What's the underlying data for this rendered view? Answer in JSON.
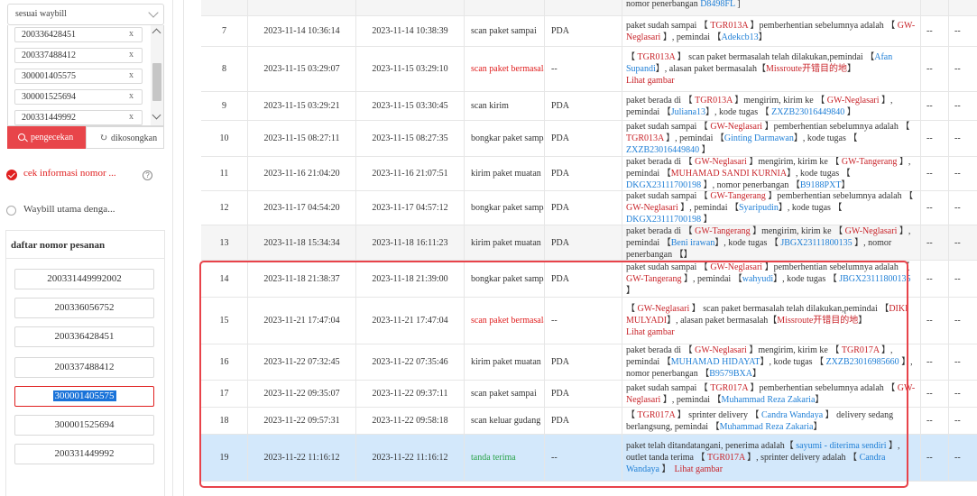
{
  "left": {
    "select_label": "sesuai waybill",
    "waybills": [
      "200336428451",
      "200337488412",
      "300001405575",
      "300001525694",
      "200331449992"
    ],
    "search_button": "pengecekan",
    "clear_button": "dikosongkan",
    "option_selected": "cek informasi nomor ...",
    "option_other": "Waybill utama denga...",
    "orders_title": "daftar nomor pesanan",
    "orders": [
      "200331449992002",
      "200336056752",
      "200336428451",
      "200337488412",
      "300001405575",
      "300001525694",
      "200331449992"
    ],
    "active_order_index": 4
  },
  "table": {
    "rows": [
      {
        "no": "",
        "t1": "",
        "t2": "",
        "type": "",
        "src": "",
        "desc": [
          [
            "",
            "nomor penerbangan "
          ],
          [
            "b",
            "D8498FL"
          ],
          [
            "",
            " ]"
          ]
        ],
        "a": "",
        "b": ""
      },
      {
        "no": "7",
        "t1": "2023-11-14 10:36:14",
        "t2": "2023-11-14 10:38:39",
        "type": "scan paket sampai",
        "src": "PDA",
        "desc": [
          [
            "",
            "paket sudah sampai 【 "
          ],
          [
            "r",
            "TGR013A"
          ],
          [
            "",
            " 】pemberhentian sebelumnya adalah 【 "
          ],
          [
            "r",
            "GW-Neglasari"
          ],
          [
            "",
            " 】, pemindai 【"
          ],
          [
            "b",
            "Adekcb13"
          ],
          [
            "",
            "】"
          ]
        ],
        "a": "--",
        "b": "--"
      },
      {
        "no": "8",
        "t1": "2023-11-15 03:29:07",
        "t2": "2023-11-15 03:29:10",
        "type": "scan paket bermasalah",
        "src": "--",
        "desc": [
          [
            "",
            "【 "
          ],
          [
            "r",
            "TGR013A"
          ],
          [
            "",
            " 】 scan paket bermasalah telah dilakukan,pemindai 【"
          ],
          [
            "b",
            "Afan Supandi"
          ],
          [
            "",
            "】, alasan paket bermasalah【"
          ],
          [
            "r",
            "Missroute开错目的地"
          ],
          [
            "",
            "】"
          ]
        ],
        "a": "--",
        "b": "--",
        "lihat": "Lihat gambar"
      },
      {
        "no": "9",
        "t1": "2023-11-15 03:29:21",
        "t2": "2023-11-15 03:30:45",
        "type": "scan kirim",
        "src": "PDA",
        "desc": [
          [
            "",
            "paket berada di 【 "
          ],
          [
            "r",
            "TGR013A"
          ],
          [
            "",
            " 】mengirim, kirim ke 【 "
          ],
          [
            "r",
            "GW-Neglasari"
          ],
          [
            "",
            " 】, pemindai 【"
          ],
          [
            "b",
            "Juliana13"
          ],
          [
            "",
            "】, kode tugas 【 "
          ],
          [
            "b",
            "ZXZB23016449840"
          ],
          [
            "",
            " 】"
          ]
        ],
        "a": "--",
        "b": "--"
      },
      {
        "no": "10",
        "t1": "2023-11-15 08:27:11",
        "t2": "2023-11-15 08:27:35",
        "type": "bongkar paket sampai",
        "src": "PDA",
        "desc": [
          [
            "",
            "paket sudah sampai 【 "
          ],
          [
            "r",
            "GW-Neglasari"
          ],
          [
            "",
            " 】pemberhentian sebelumnya adalah 【 "
          ],
          [
            "r",
            "TGR013A"
          ],
          [
            "",
            " 】, pemindai 【"
          ],
          [
            "b",
            "Ginting Darmawan"
          ],
          [
            "",
            "】, kode tugas 【 "
          ],
          [
            "b",
            "ZXZB23016449840"
          ],
          [
            "",
            " 】"
          ]
        ],
        "a": "--",
        "b": "--"
      },
      {
        "no": "11",
        "t1": "2023-11-16 21:04:20",
        "t2": "2023-11-16 21:07:51",
        "type": "kirim paket muatan",
        "src": "PDA",
        "desc": [
          [
            "",
            "paket berada di 【 "
          ],
          [
            "r",
            "GW-Neglasari"
          ],
          [
            "",
            " 】mengirim, kirim ke 【 "
          ],
          [
            "r",
            "GW-Tangerang"
          ],
          [
            "",
            " 】, pemindai 【"
          ],
          [
            "r",
            "MUHAMAD SANDI KURNIA"
          ],
          [
            "",
            "】, kode tugas 【 "
          ],
          [
            "b",
            "DKGX23111700198"
          ],
          [
            "",
            " 】, nomor penerbangan 【"
          ],
          [
            "b",
            "B9188PXT"
          ],
          [
            "",
            "】"
          ]
        ],
        "a": "--",
        "b": "--"
      },
      {
        "no": "12",
        "t1": "2023-11-17 04:54:20",
        "t2": "2023-11-17 04:57:12",
        "type": "bongkar paket sampai",
        "src": "PDA",
        "desc": [
          [
            "",
            "paket sudah sampai 【 "
          ],
          [
            "r",
            "GW-Tangerang"
          ],
          [
            "",
            " 】pemberhentian sebelumnya adalah 【 "
          ],
          [
            "r",
            "GW-Neglasari"
          ],
          [
            "",
            " 】, pemindai 【"
          ],
          [
            "b",
            "Syaripudin"
          ],
          [
            "",
            "】, kode tugas 【 "
          ],
          [
            "b",
            "DKGX23111700198"
          ],
          [
            "",
            " 】"
          ]
        ],
        "a": "--",
        "b": "--"
      },
      {
        "no": "13",
        "t1": "2023-11-18 15:34:34",
        "t2": "2023-11-18 16:11:23",
        "type": "kirim paket muatan",
        "src": "PDA",
        "desc": [
          [
            "",
            "paket berada di 【 "
          ],
          [
            "r",
            "GW-Tangerang"
          ],
          [
            "",
            " 】mengirim, kirim ke 【 "
          ],
          [
            "r",
            "GW-Neglasari"
          ],
          [
            "",
            " 】, pemindai 【"
          ],
          [
            "b",
            "Beni irawan"
          ],
          [
            "",
            "】, kode tugas 【 "
          ],
          [
            "b",
            "JBGX23111800135"
          ],
          [
            "",
            " 】, nomor penerbangan 【"
          ],
          [
            "",
            "】"
          ]
        ],
        "a": "--",
        "b": "--"
      },
      {
        "no": "14",
        "t1": "2023-11-18 21:38:37",
        "t2": "2023-11-18 21:39:00",
        "type": "bongkar paket sampai",
        "src": "PDA",
        "desc": [
          [
            "",
            "paket sudah sampai 【 "
          ],
          [
            "r",
            "GW-Neglasari"
          ],
          [
            "",
            " 】pemberhentian sebelumnya adalah 【 "
          ],
          [
            "r",
            "GW-Tangerang"
          ],
          [
            "",
            " 】, pemindai 【"
          ],
          [
            "b",
            "wahyudi"
          ],
          [
            "",
            "】, kode tugas 【 "
          ],
          [
            "b",
            "JBGX23111800135"
          ],
          [
            "",
            " 】"
          ]
        ],
        "a": "--",
        "b": "--"
      },
      {
        "no": "15",
        "t1": "2023-11-21 17:47:04",
        "t2": "2023-11-21 17:47:04",
        "type": "scan paket bermasalah",
        "src": "--",
        "desc": [
          [
            "",
            "【 "
          ],
          [
            "r",
            "GW-Neglasari"
          ],
          [
            "",
            " 】 scan paket bermasalah telah dilakukan,pemindai 【"
          ],
          [
            "r",
            "DIKI MULYADI"
          ],
          [
            "",
            "】, alasan paket bermasalah【"
          ],
          [
            "r",
            "Missroute开错目的地"
          ],
          [
            "",
            "】"
          ]
        ],
        "a": "--",
        "b": "--",
        "lihat": "Lihat gambar"
      },
      {
        "no": "16",
        "t1": "2023-11-22 07:32:45",
        "t2": "2023-11-22 07:35:46",
        "type": "kirim paket muatan",
        "src": "PDA",
        "desc": [
          [
            "",
            "paket berada di 【 "
          ],
          [
            "r",
            "GW-Neglasari"
          ],
          [
            "",
            " 】mengirim, kirim ke 【 "
          ],
          [
            "r",
            "TGR017A"
          ],
          [
            "",
            " 】, pemindai 【"
          ],
          [
            "b",
            "MUHAMAD HIDAYAT"
          ],
          [
            "",
            "】, kode tugas 【 "
          ],
          [
            "b",
            "ZXZB23016985660"
          ],
          [
            "",
            " 】, nomor penerbangan 【"
          ],
          [
            "b",
            "B9579BXA"
          ],
          [
            "",
            "】"
          ]
        ],
        "a": "--",
        "b": "--"
      },
      {
        "no": "17",
        "t1": "2023-11-22 09:35:07",
        "t2": "2023-11-22 09:37:11",
        "type": "scan paket sampai",
        "src": "PDA",
        "desc": [
          [
            "",
            "paket sudah sampai 【 "
          ],
          [
            "r",
            "TGR017A"
          ],
          [
            "",
            " 】pemberhentian sebelumnya adalah 【 "
          ],
          [
            "r",
            "GW-Neglasari"
          ],
          [
            "",
            " 】, pemindai 【"
          ],
          [
            "b",
            "Muhammad Reza Zakaria"
          ],
          [
            "",
            "】"
          ]
        ],
        "a": "--",
        "b": "--"
      },
      {
        "no": "18",
        "t1": "2023-11-22 09:57:31",
        "t2": "2023-11-22 09:58:18",
        "type": "scan keluar gudang",
        "src": "PDA",
        "desc": [
          [
            "",
            "【 "
          ],
          [
            "r",
            "TGR017A"
          ],
          [
            "",
            " 】 sprinter delivery 【 "
          ],
          [
            "b",
            "Candra Wandaya"
          ],
          [
            "",
            " 】 delivery sedang berlangsung, pemindai 【"
          ],
          [
            "b",
            "Muhammad Reza Zakaria"
          ],
          [
            "",
            "】"
          ]
        ],
        "a": "--",
        "b": "--"
      },
      {
        "no": "19",
        "t1": "2023-11-22 11:16:12",
        "t2": "2023-11-22 11:16:12",
        "type": "tanda terima",
        "src": "--",
        "desc": [
          [
            "",
            "paket telah ditandatangani, penerima adalah【 "
          ],
          [
            "b",
            "sayumi - diterima sendiri"
          ],
          [
            "",
            " 】, outlet tanda terima 【 "
          ],
          [
            "r",
            "TGR017A"
          ],
          [
            "",
            " 】, sprinter delivery adalah 【 "
          ],
          [
            "b",
            "Candra Wandaya"
          ],
          [
            "",
            " 】"
          ]
        ],
        "a": "--",
        "b": "--",
        "lihat": "Lihat gambar"
      }
    ]
  }
}
